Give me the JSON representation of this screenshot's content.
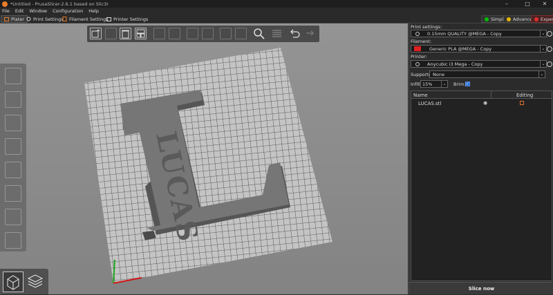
{
  "window": {
    "title": "*Untitled - PrusaSlicer-2.6.1 based on Slic3r",
    "minimize": "–",
    "maximize": "□",
    "close": "✕"
  },
  "menu": [
    "File",
    "Edit",
    "Window",
    "Configuration",
    "Help"
  ],
  "tabs": [
    {
      "label": "Plater",
      "icon": "plater-icon"
    },
    {
      "label": "Print Settings",
      "icon": "gear-icon"
    },
    {
      "label": "Filament Settings",
      "icon": "spool-icon"
    },
    {
      "label": "Printer Settings",
      "icon": "printer-icon"
    }
  ],
  "modes": [
    {
      "label": "Simple",
      "color": "#00c000"
    },
    {
      "label": "Advanced",
      "color": "#e8b800"
    },
    {
      "label": "Expert",
      "color": "#e03030"
    }
  ],
  "scene": {
    "object_text": "LUCAS",
    "bed_color": "#c6c6c6",
    "grid_color": "#3a3a3a",
    "model_color": "#7a7a7a"
  },
  "sidebar": {
    "print_settings_label": "Print settings:",
    "print_settings_value": "0.15mm QUALITY @MEGA - Copy",
    "filament_label": "Filament:",
    "filament_value": "Generic PLA @MEGA - Copy",
    "filament_color": "#e02020",
    "printer_label": "Printer:",
    "printer_value": "Anycubic i3 Mega - Copy",
    "supports_label": "Supports:",
    "supports_value": "None",
    "infill_label": "Infill:",
    "infill_value": "15%",
    "brim_label": "Brim:",
    "brim_checked": true
  },
  "object_list": {
    "col_name": "Name",
    "col_editing": "Editing",
    "rows": [
      {
        "name": "LUCAS.stl"
      }
    ]
  },
  "slice_button": "Slice now"
}
